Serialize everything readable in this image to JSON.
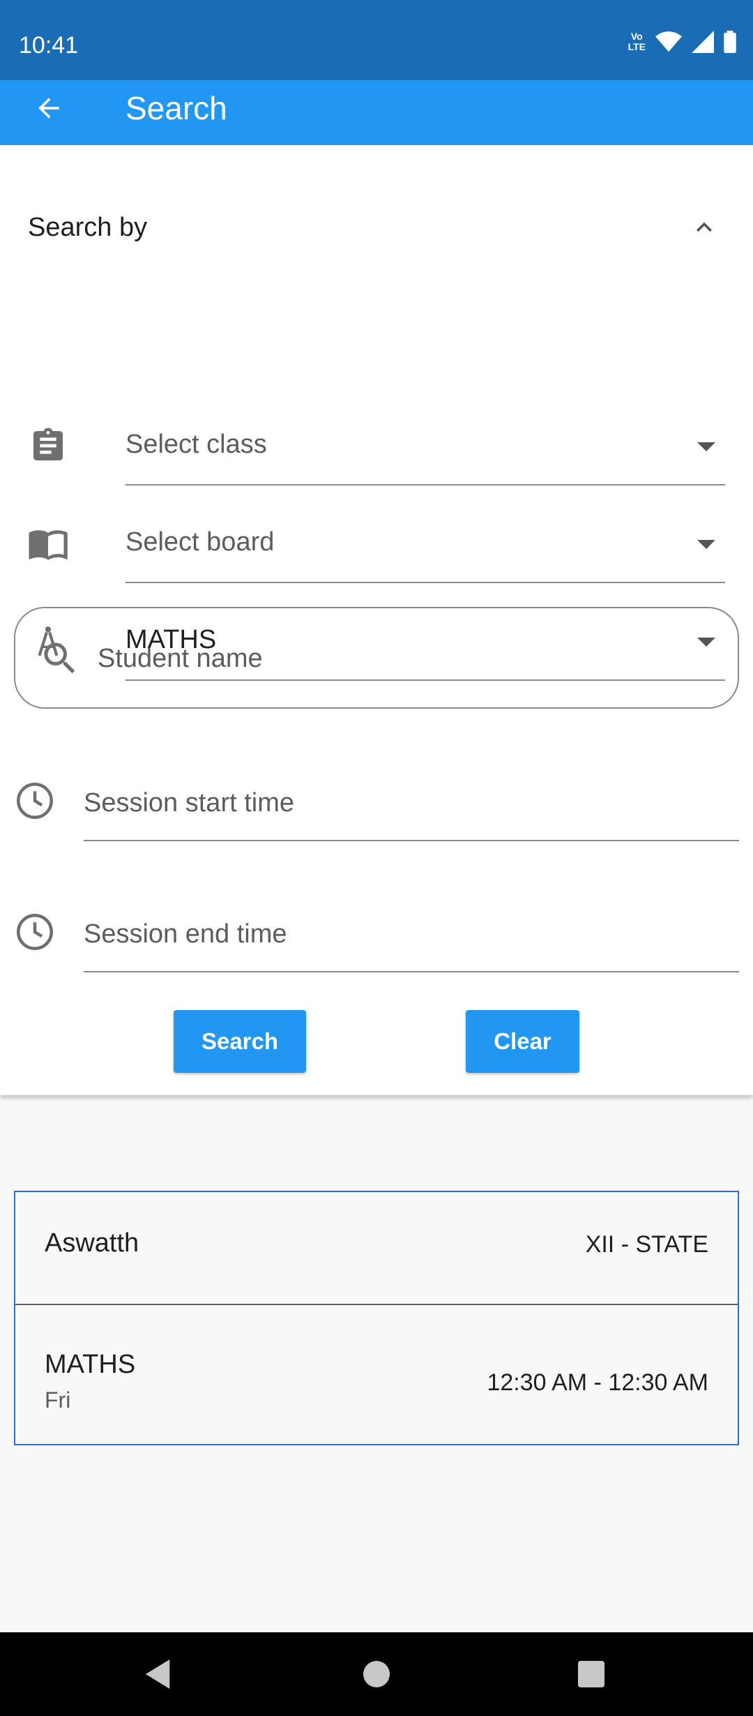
{
  "status_bar": {
    "time": "10:41",
    "network_label": "Vo LTE"
  },
  "app_bar": {
    "title": "Search",
    "back_icon": "arrow-back-icon"
  },
  "filters": {
    "header_label": "Search by",
    "header_state": "expanded",
    "class_placeholder": "Select class",
    "board_placeholder": "Select board",
    "subject_value": "MATHS",
    "student_placeholder": "Student name",
    "start_time_placeholder": "Session start time",
    "end_time_placeholder": "Session end time",
    "search_label": "Search",
    "clear_label": "Clear"
  },
  "result": {
    "student_name": "Aswatth",
    "class_board": "XII - STATE",
    "subject": "MATHS",
    "day": "Fri",
    "time_range": "12:30 AM - 12:30 AM"
  },
  "colors": {
    "status_bar": "#1a6db5",
    "app_bar": "#2196f3",
    "button": "#2196f3",
    "card_border": "#2d6fd1"
  }
}
